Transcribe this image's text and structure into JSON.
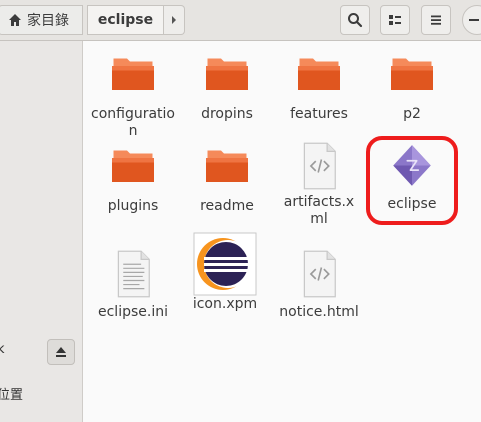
{
  "breadcrumb": {
    "home_label": "家目錄",
    "current_label": "eclipse"
  },
  "toolbar": {
    "search_icon": "search-icon",
    "view_icon": "grid-view-icon",
    "menu_icon": "hamburger-menu-icon"
  },
  "sidebar": {
    "device_label": "k",
    "other_label": "位置"
  },
  "files": [
    {
      "label": "configuration",
      "type": "folder"
    },
    {
      "label": "dropins",
      "type": "folder"
    },
    {
      "label": "features",
      "type": "folder"
    },
    {
      "label": "p2",
      "type": "folder"
    },
    {
      "label": "plugins",
      "type": "folder"
    },
    {
      "label": "readme",
      "type": "folder"
    },
    {
      "label": "artifacts.xml",
      "type": "code-file"
    },
    {
      "label": "eclipse",
      "type": "executable"
    },
    {
      "label": "eclipse.ini",
      "type": "text-file"
    },
    {
      "label": "icon.xpm",
      "type": "image"
    },
    {
      "label": "notice.html",
      "type": "code-file"
    }
  ],
  "colors": {
    "folder_top": "#f58a5a",
    "folder_body": "#e0561f",
    "highlight": "#ee1c1c",
    "eclipse_purple": "#2c2255",
    "eclipse_orange": "#f7941e"
  }
}
